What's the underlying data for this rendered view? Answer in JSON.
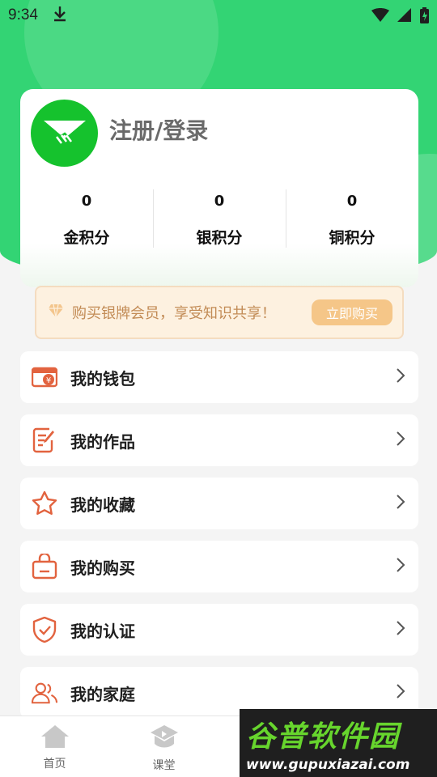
{
  "status_bar": {
    "time": "9:34"
  },
  "profile": {
    "login_text": "注册/登录",
    "points": [
      {
        "value": "0",
        "label": "金积分"
      },
      {
        "value": "0",
        "label": "银积分"
      },
      {
        "value": "0",
        "label": "铜积分"
      }
    ]
  },
  "promo": {
    "text": "购买银牌会员，享受知识共享！",
    "button": "立即购买"
  },
  "menu": [
    {
      "label": "我的钱包",
      "icon": "wallet-icon"
    },
    {
      "label": "我的作品",
      "icon": "document-edit-icon"
    },
    {
      "label": "我的收藏",
      "icon": "star-icon"
    },
    {
      "label": "我的购买",
      "icon": "shopping-bag-icon"
    },
    {
      "label": "我的认证",
      "icon": "shield-check-icon"
    },
    {
      "label": "我的家庭",
      "icon": "family-icon"
    }
  ],
  "bottom_nav": [
    {
      "label": "首页",
      "icon": "home-icon"
    },
    {
      "label": "课堂",
      "icon": "classroom-icon"
    }
  ],
  "watermark": {
    "title": "谷普软件园",
    "url": "www.gupuxiazai.com"
  },
  "colors": {
    "brand_green": "#33d474",
    "menu_icon": "#e2633f",
    "promo_text": "#c28b55"
  }
}
